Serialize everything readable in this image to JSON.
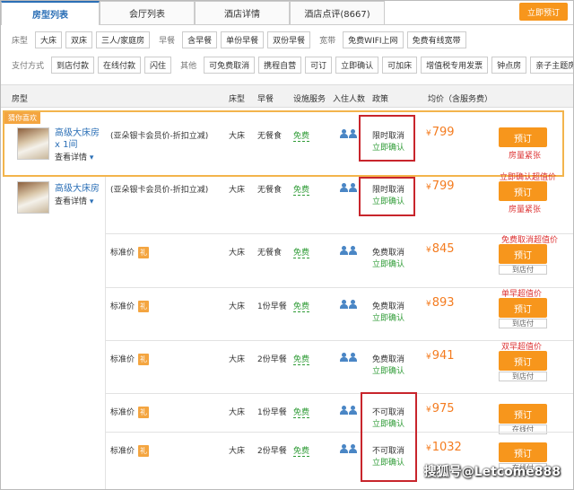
{
  "tabs": [
    "房型列表",
    "会厅列表",
    "酒店详情",
    "酒店点评(8667)"
  ],
  "book_now": "立即预订",
  "filters": {
    "bed_label": "床型",
    "bed": [
      "大床",
      "双床",
      "三人/家庭房"
    ],
    "breakfast_label": "早餐",
    "breakfast": [
      "含早餐",
      "单份早餐",
      "双份早餐"
    ],
    "broadband_label": "宽带",
    "broadband": [
      "免费WIFI上网",
      "免费有线宽带"
    ],
    "pay_label": "支付方式",
    "pay": [
      "到店付款",
      "在线付款",
      "闪住"
    ],
    "other_label": "其他",
    "other": [
      "可免费取消",
      "携程自营",
      "可订",
      "立即确认",
      "可加床",
      "增值税专用发票",
      "钟点房",
      "亲子主题房"
    ]
  },
  "header": {
    "room_type": "房型",
    "bed": "床型",
    "breakfast": "早餐",
    "facility": "设施服务",
    "guests": "入住人数",
    "policy": "政策",
    "price": "均价（含服务费）"
  },
  "featured_tag": "猜你喜欢",
  "rooms": [
    {
      "name": "高级大床房x 1间",
      "details": "查看详情"
    },
    {
      "name": "高级大床房",
      "details": "查看详情"
    }
  ],
  "rows": [
    {
      "plan": "(亚朵银卡会员价-折扣立减)",
      "bed": "大床",
      "breakfast": "无餐食",
      "facility": "免费",
      "policy": "限时取消",
      "confirm": "立即确认",
      "price": "799",
      "currency": "¥",
      "book": "预订",
      "note": "房量紧张",
      "promo": ""
    },
    {
      "plan": "(亚朵银卡会员价-折扣立减)",
      "bed": "大床",
      "breakfast": "无餐食",
      "facility": "免费",
      "policy": "限时取消",
      "confirm": "立即确认",
      "price": "799",
      "currency": "¥",
      "book": "预订",
      "note": "房量紧张",
      "promo": "立即确认超值价"
    },
    {
      "plan": "标准价",
      "gift": "礼",
      "bed": "大床",
      "breakfast": "无餐食",
      "facility": "免费",
      "policy": "免费取消",
      "confirm": "立即确认",
      "price": "845",
      "currency": "¥",
      "book": "预订",
      "pay": "到店付",
      "promo": "免费取消超值价"
    },
    {
      "plan": "标准价",
      "gift": "礼",
      "bed": "大床",
      "breakfast": "1份早餐",
      "facility": "免费",
      "policy": "免费取消",
      "confirm": "立即确认",
      "price": "893",
      "currency": "¥",
      "book": "预订",
      "pay": "到店付",
      "promo": "单早超值价"
    },
    {
      "plan": "标准价",
      "gift": "礼",
      "bed": "大床",
      "breakfast": "2份早餐",
      "facility": "免费",
      "policy": "免费取消",
      "confirm": "立即确认",
      "price": "941",
      "currency": "¥",
      "book": "预订",
      "pay": "到店付",
      "promo": "双早超值价"
    },
    {
      "plan": "标准价",
      "gift": "礼",
      "bed": "大床",
      "breakfast": "1份早餐",
      "facility": "免费",
      "policy": "不可取消",
      "confirm": "立即确认",
      "price": "975",
      "currency": "¥",
      "book": "预订",
      "pay": "在线付",
      "promo": ""
    },
    {
      "plan": "标准价",
      "gift": "礼",
      "bed": "大床",
      "breakfast": "2份早餐",
      "facility": "免费",
      "policy": "不可取消",
      "confirm": "立即确认",
      "price": "1032",
      "currency": "¥",
      "book": "预订",
      "pay": "在线付",
      "promo": ""
    }
  ],
  "watermark": "搜狐号@Letcome888"
}
